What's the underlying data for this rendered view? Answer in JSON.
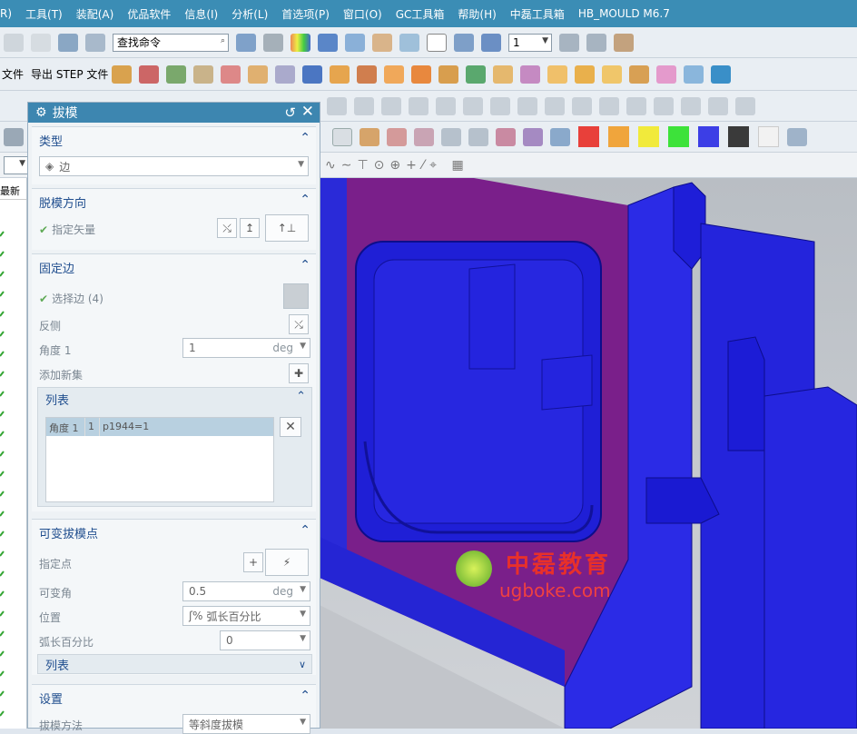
{
  "menubar": {
    "items": [
      "R)",
      "工具(T)",
      "装配(A)",
      "优品软件",
      "信息(I)",
      "分析(L)",
      "首选项(P)",
      "窗口(O)",
      "GC工具箱",
      "帮助(H)",
      "中磊工具箱",
      "HB_MOULD M6.7"
    ]
  },
  "toolbar1": {
    "search_placeholder": "查找命令",
    "layer_value": "1"
  },
  "toolbar2": {
    "import_label": "文件",
    "export_step_label": "导出 STEP 文件"
  },
  "colors": [
    "#e8403a",
    "#f0a53c",
    "#f1ea3b",
    "#3de23a",
    "#3c3ee6",
    "#3a3a3a",
    "#f2f2f2"
  ],
  "navtree": {
    "header": "最新"
  },
  "dialog": {
    "title": "拔模",
    "type_section": {
      "title": "类型",
      "value": "边"
    },
    "direction_section": {
      "title": "脱模方向",
      "label": "指定矢量"
    },
    "fixed_edge_section": {
      "title": "固定边",
      "select_label": "选择边 (4)",
      "reverse_label": "反侧",
      "angle_label": "角度 1",
      "angle_value": "1",
      "angle_unit": "deg",
      "add_set_label": "添加新集"
    },
    "list": {
      "title": "列表",
      "row": [
        "角度 1",
        "1",
        "p1944=1"
      ]
    },
    "variable_section": {
      "title": "可变拔模点",
      "point_label": "指定点",
      "angle_label": "可变角",
      "angle_value": "0.5",
      "angle_unit": "deg",
      "position_label": "位置",
      "position_value": "弧长百分比",
      "percent_label": "弧长百分比",
      "percent_value": "0",
      "list_title": "列表"
    },
    "settings_section": {
      "title": "设置",
      "method_label": "拔模方法",
      "method_value": "等斜度拔模"
    }
  },
  "watermark": {
    "cn": "中磊教育",
    "url": "ugboke.com"
  }
}
